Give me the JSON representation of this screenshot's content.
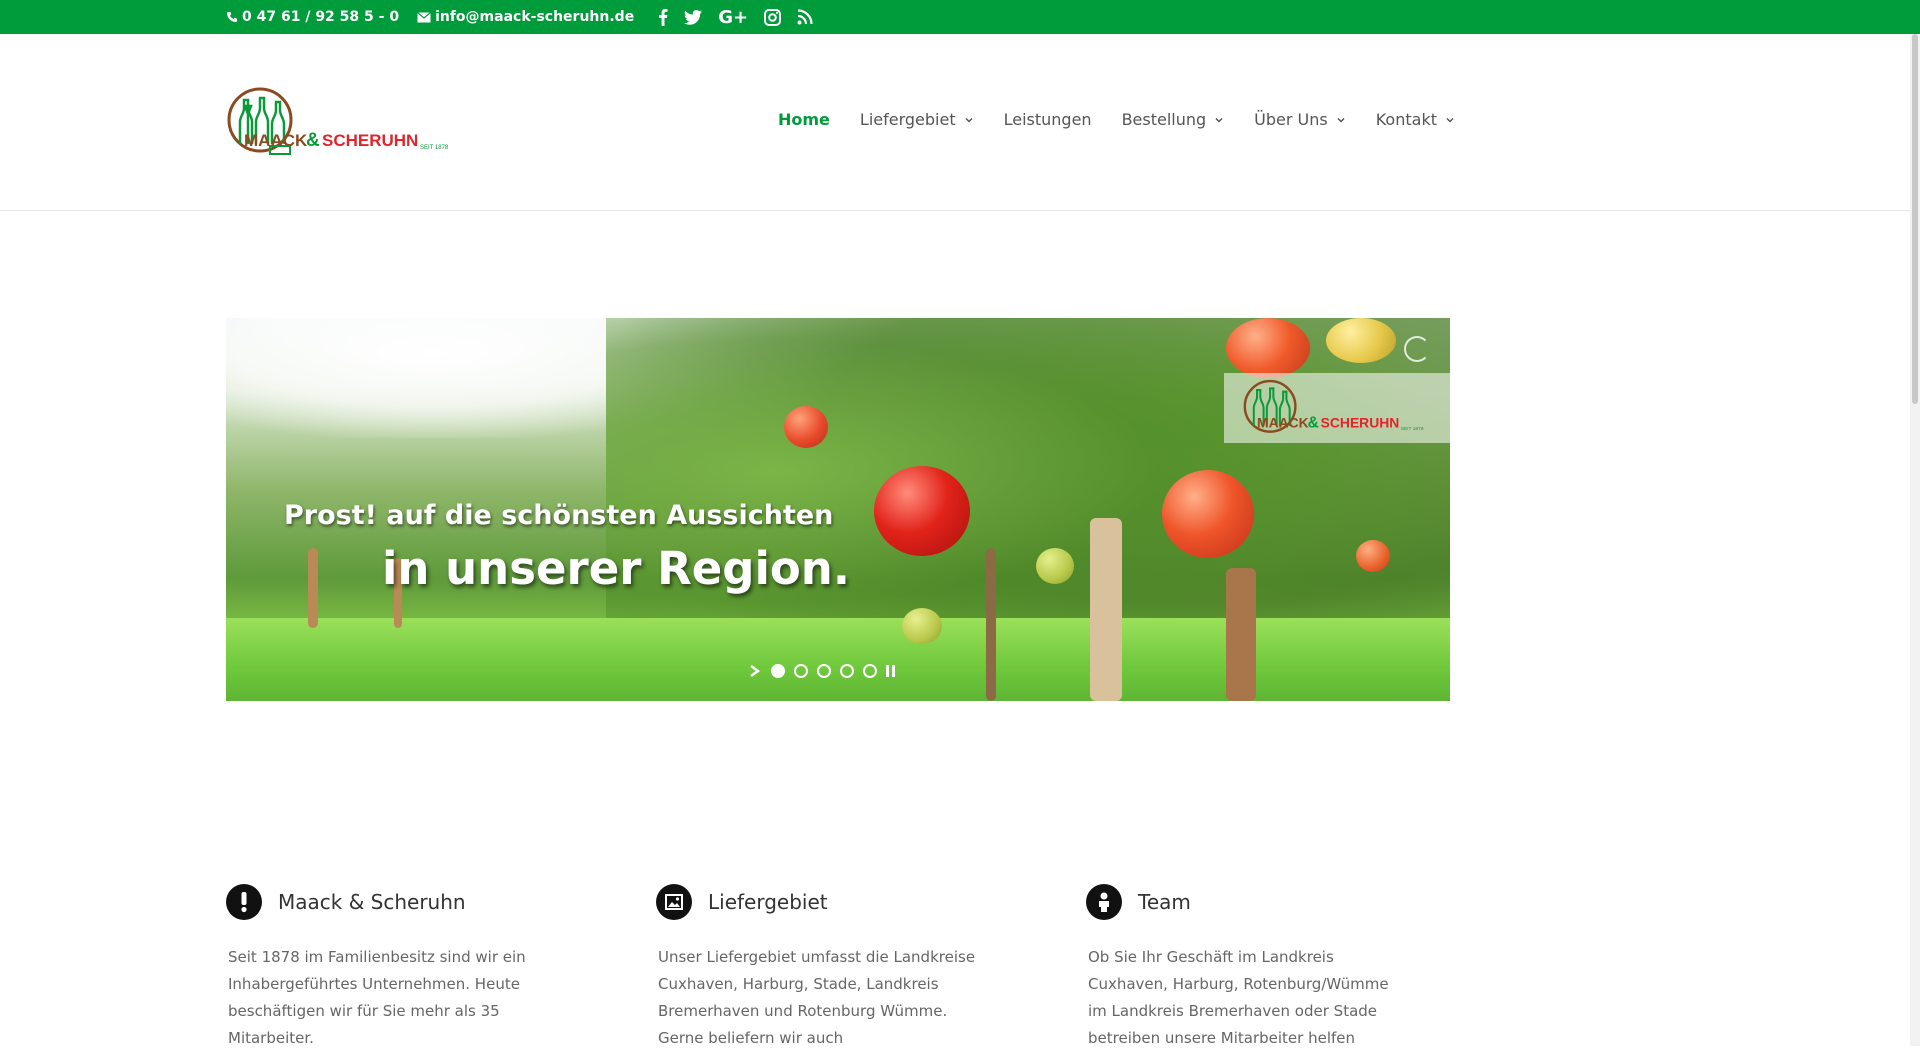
{
  "topbar": {
    "phone": "0 47 61 / 92 58 5 - 0",
    "email": "info@maack-scheruhn.de",
    "social_icons": [
      "facebook-icon",
      "twitter-icon",
      "google-plus-icon",
      "instagram-icon",
      "rss-icon"
    ],
    "background_color": "#009b3a"
  },
  "header": {
    "logo": {
      "brand_left": "MAACK",
      "brand_amp": "&",
      "brand_right": "SCHERUHN",
      "since": "SEIT 1878",
      "colors": {
        "brown": "#8b4a1f",
        "green": "#0a9a3a",
        "red": "#e3242b"
      }
    },
    "nav": [
      {
        "label": "Home",
        "active": true,
        "has_dropdown": false
      },
      {
        "label": "Liefergebiet",
        "active": false,
        "has_dropdown": true
      },
      {
        "label": "Leistungen",
        "active": false,
        "has_dropdown": false
      },
      {
        "label": "Bestellung",
        "active": false,
        "has_dropdown": true
      },
      {
        "label": "Über Uns",
        "active": false,
        "has_dropdown": true
      },
      {
        "label": "Kontakt",
        "active": false,
        "has_dropdown": true
      }
    ],
    "accent_color": "#009b3a"
  },
  "hero": {
    "line1": "Prost! auf die schönsten Aussichten",
    "line2": "in unserer Region.",
    "slides_count": 5,
    "active_slide": 1
  },
  "features": [
    {
      "icon": "exclamation-icon",
      "title": "Maack & Scheruhn",
      "text": "Seit 1878 im Familienbesitz sind wir ein Inhabergeführtes Unternehmen. Heute beschäftigen wir für Sie mehr als 35 Mitarbeiter."
    },
    {
      "icon": "image-icon",
      "title": "Liefergebiet",
      "text": "Unser Liefergebiet umfasst die Landkreise Cuxhaven, Harburg, Stade, Landkreis Bremerhaven und Rotenburg Wümme. Gerne beliefern wir auch"
    },
    {
      "icon": "person-icon",
      "title": "Team",
      "text": "Ob Sie Ihr Geschäft im Landkreis Cuxhaven, Harburg, Rotenburg/Wümme im Landkreis Bremerhaven oder Stade  betreiben unsere Mitarbeiter helfen"
    }
  ]
}
